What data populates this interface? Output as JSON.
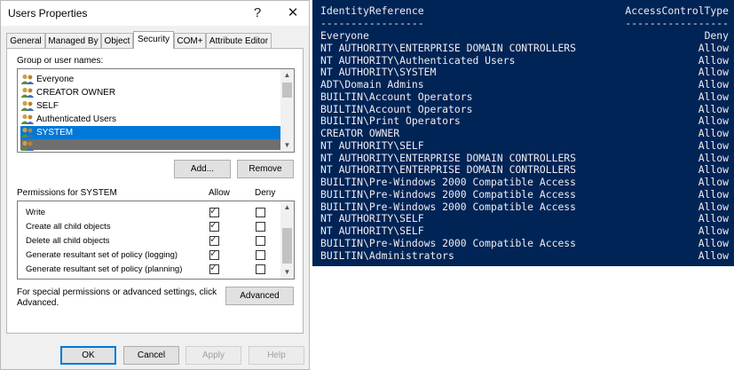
{
  "dialog": {
    "title": "Users Properties",
    "help_glyph": "?",
    "close_glyph": "✕",
    "tabs": [
      {
        "label": "General"
      },
      {
        "label": "Managed By"
      },
      {
        "label": "Object"
      },
      {
        "label": "Security"
      },
      {
        "label": "COM+"
      },
      {
        "label": "Attribute Editor"
      }
    ],
    "active_tab": "Security",
    "groups_label": "Group or user names:",
    "users": [
      {
        "name": "Everyone",
        "selected": false
      },
      {
        "name": "CREATOR OWNER",
        "selected": false
      },
      {
        "name": "SELF",
        "selected": false
      },
      {
        "name": "Authenticated Users",
        "selected": false
      },
      {
        "name": "SYSTEM",
        "selected": true
      },
      {
        "name": "",
        "selected": false,
        "redacted": true
      }
    ],
    "add_button": "Add...",
    "remove_button": "Remove",
    "permissions_label": "Permissions for SYSTEM",
    "allow_header": "Allow",
    "deny_header": "Deny",
    "permissions": [
      {
        "name": "Write",
        "allow": true,
        "deny": false
      },
      {
        "name": "Create all child objects",
        "allow": true,
        "deny": false
      },
      {
        "name": "Delete all child objects",
        "allow": true,
        "deny": false
      },
      {
        "name": "Generate resultant set of policy (logging)",
        "allow": true,
        "deny": false
      },
      {
        "name": "Generate resultant set of policy (planning)",
        "allow": true,
        "deny": false
      }
    ],
    "special_text_line1": "For special permissions or advanced settings, click",
    "special_text_line2": "Advanced.",
    "advanced_button": "Advanced",
    "ok_button": "OK",
    "cancel_button": "Cancel",
    "apply_button": "Apply",
    "help_button": "Help",
    "colors": {
      "selection": "#0078d7",
      "console_bg": "#012456"
    }
  },
  "console": {
    "header": {
      "identity": "IdentityReference",
      "access": "AccessControlType"
    },
    "underline": {
      "identity": "-----------------",
      "access": "-----------------"
    },
    "rows": [
      {
        "identity": "Everyone",
        "access": "Deny"
      },
      {
        "identity": "NT AUTHORITY\\ENTERPRISE DOMAIN CONTROLLERS",
        "access": "Allow"
      },
      {
        "identity": "NT AUTHORITY\\Authenticated Users",
        "access": "Allow"
      },
      {
        "identity": "NT AUTHORITY\\SYSTEM",
        "access": "Allow"
      },
      {
        "identity": "ADT\\Domain Admins",
        "access": "Allow"
      },
      {
        "identity": "BUILTIN\\Account Operators",
        "access": "Allow"
      },
      {
        "identity": "BUILTIN\\Account Operators",
        "access": "Allow"
      },
      {
        "identity": "BUILTIN\\Print Operators",
        "access": "Allow"
      },
      {
        "identity": "CREATOR OWNER",
        "access": "Allow"
      },
      {
        "identity": "NT AUTHORITY\\SELF",
        "access": "Allow"
      },
      {
        "identity": "NT AUTHORITY\\ENTERPRISE DOMAIN CONTROLLERS",
        "access": "Allow"
      },
      {
        "identity": "NT AUTHORITY\\ENTERPRISE DOMAIN CONTROLLERS",
        "access": "Allow"
      },
      {
        "identity": "BUILTIN\\Pre-Windows 2000 Compatible Access",
        "access": "Allow"
      },
      {
        "identity": "BUILTIN\\Pre-Windows 2000 Compatible Access",
        "access": "Allow"
      },
      {
        "identity": "BUILTIN\\Pre-Windows 2000 Compatible Access",
        "access": "Allow"
      },
      {
        "identity": "NT AUTHORITY\\SELF",
        "access": "Allow"
      },
      {
        "identity": "NT AUTHORITY\\SELF",
        "access": "Allow"
      },
      {
        "identity": "BUILTIN\\Pre-Windows 2000 Compatible Access",
        "access": "Allow"
      },
      {
        "identity": "BUILTIN\\Administrators",
        "access": "Allow"
      }
    ]
  }
}
